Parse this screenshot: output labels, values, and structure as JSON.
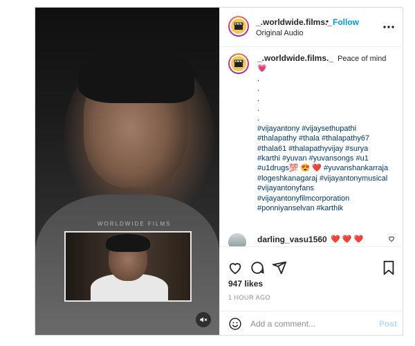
{
  "header": {
    "username": "_.worldwide.films._",
    "separator": "•",
    "follow_label": "Follow",
    "audio_label": "Original Audio"
  },
  "media": {
    "watermark": "WORLDWIDE FILMS",
    "mute_icon": "speaker-muted-icon"
  },
  "caption": {
    "username": "_.worldwide.films._",
    "text": "Peace of mind 💗",
    "dots": [
      ".",
      ".",
      ".",
      ".",
      "."
    ],
    "hashtag_lines": [
      "#vijayantony #vijaysethupathi",
      "#thalapathy #thala #thalapathy67",
      "#thala61 #thalapathyvijay #surya",
      "#karthi #yuvan #yuvansongs #u1",
      "#u1drugs💯 😍 ❤️ #yuvanshankarraja",
      "#logeshkanagaraj #vijayantonymusical",
      "#vijayantonyfans",
      "#vijayantonyfilmcorporation",
      "#ponniyanselvan #karthik"
    ],
    "time": "1h"
  },
  "comment": {
    "username": "darling_vasu1560",
    "text": "❤️ ❤️ ❤️"
  },
  "actions": {
    "likes": "947 likes",
    "ago": "1 HOUR AGO",
    "add_comment_placeholder": "Add a comment...",
    "post_label": "Post"
  },
  "colors": {
    "link": "#0095f6",
    "hashtag": "#00376b",
    "muted_text": "#8e8e8e",
    "border": "#dbdbdb"
  }
}
